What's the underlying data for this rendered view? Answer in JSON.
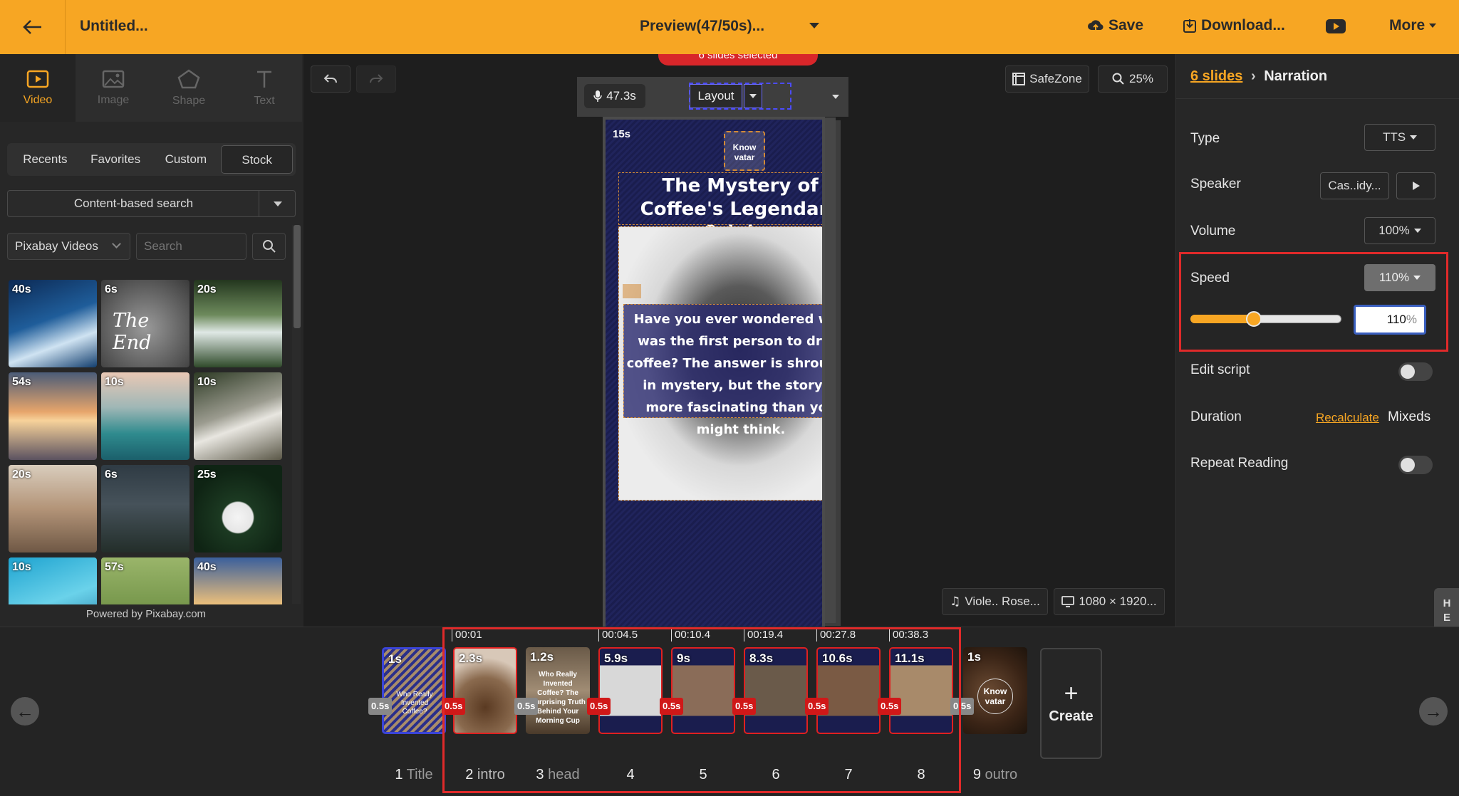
{
  "topbar": {
    "title": "Untitled...",
    "preview": "Preview(47/50s)...",
    "save": "Save",
    "download": "Download...",
    "more": "More"
  },
  "tools": [
    {
      "label": "Video",
      "icon": "video-icon"
    },
    {
      "label": "Image",
      "icon": "image-icon"
    },
    {
      "label": "Shape",
      "icon": "pentagon-icon"
    },
    {
      "label": "Text",
      "icon": "text-icon"
    }
  ],
  "source_tabs": [
    "Recents",
    "Favorites",
    "Custom",
    "Stock"
  ],
  "content_search": "Content-based search",
  "provider": "Pixabay Videos",
  "search_placeholder": "Search",
  "stock": [
    {
      "dur": "40s",
      "label": ""
    },
    {
      "dur": "6s",
      "label": "The End"
    },
    {
      "dur": "20s",
      "label": ""
    },
    {
      "dur": "54s",
      "label": ""
    },
    {
      "dur": "10s",
      "label": ""
    },
    {
      "dur": "10s",
      "label": ""
    },
    {
      "dur": "20s",
      "label": ""
    },
    {
      "dur": "6s",
      "label": ""
    },
    {
      "dur": "25s",
      "label": ""
    },
    {
      "dur": "10s",
      "label": ""
    },
    {
      "dur": "57s",
      "label": ""
    },
    {
      "dur": "40s",
      "label": ""
    }
  ],
  "powered": "Powered by Pixabay.com",
  "canvas": {
    "selection_banner": "6 slides selected",
    "mic_duration": "47.3s",
    "layout": "Layout",
    "safezone": "SafeZone",
    "zoom": "25%",
    "slide_duration": "15s",
    "avatar_text": "Know vatar",
    "heading": "The Mystery of Coffee's Legendary Origins",
    "body": "Have you ever wondered who was the first person to drink coffee? The answer is shrouded in mystery, but the story is more fascinating than you might think.",
    "music": "Viole.. Rose...",
    "resolution": "1080 × 1920..."
  },
  "panel": {
    "breadcrumb_link": "6 slides",
    "breadcrumb_current": "Narration",
    "type_label": "Type",
    "type_value": "TTS",
    "speaker_label": "Speaker",
    "speaker_value": "Cas..idy...",
    "volume_label": "Volume",
    "volume_value": "100%",
    "speed_label": "Speed",
    "speed_value": "110%",
    "speed_input": "110",
    "speed_unit": "%",
    "speed_slider": 0.42,
    "edit_script_label": "Edit script",
    "duration_label": "Duration",
    "recalculate": "Recalculate",
    "duration_value": "Mixeds",
    "repeat_label": "Repeat Reading",
    "edit_script_on": false,
    "repeat_on": false
  },
  "help": "HELP",
  "timeline": {
    "create": "Create",
    "clips": [
      {
        "dur": "1s",
        "num": "1",
        "name": "Title",
        "start": "",
        "trans": "0.5s",
        "text": "Who Really Invented Coffee?"
      },
      {
        "dur": "2.3s",
        "num": "2",
        "name": "intro",
        "start": "00:01",
        "trans": "0.5s",
        "text": ""
      },
      {
        "dur": "1.2s",
        "num": "3",
        "name": "head",
        "start": "",
        "trans": "0.5s",
        "text": "Who Really Invented Coffee? The Surprising Truth Behind Your Morning Cup"
      },
      {
        "dur": "5.9s",
        "num": "4",
        "name": "",
        "start": "00:04.5",
        "trans": "0.5s",
        "text": ""
      },
      {
        "dur": "9s",
        "num": "5",
        "name": "",
        "start": "00:10.4",
        "trans": "0.5s",
        "text": ""
      },
      {
        "dur": "8.3s",
        "num": "6",
        "name": "",
        "start": "00:19.4",
        "trans": "0.5s",
        "text": ""
      },
      {
        "dur": "10.6s",
        "num": "7",
        "name": "",
        "start": "00:27.8",
        "trans": "0.5s",
        "text": ""
      },
      {
        "dur": "11.1s",
        "num": "8",
        "name": "",
        "start": "00:38.3",
        "trans": "0.5s",
        "text": ""
      },
      {
        "dur": "1s",
        "num": "9",
        "name": "outro",
        "start": "",
        "trans": "",
        "text": "Know vatar"
      }
    ]
  }
}
